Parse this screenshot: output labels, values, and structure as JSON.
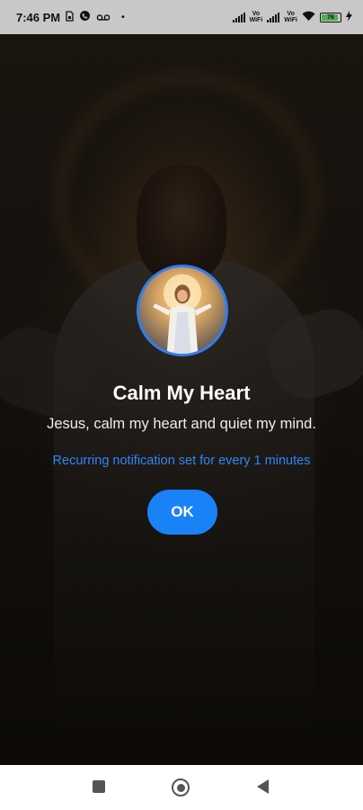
{
  "status_bar": {
    "time": "7:46 PM",
    "left_icons": [
      "sim-icon",
      "whatsapp-icon",
      "voicemail-icon"
    ],
    "dot": "•",
    "vowifi_1": "Vo\nWiFi",
    "vowifi_2": "Vo\nWiFi",
    "battery_level": "76",
    "charging": true
  },
  "dialog": {
    "title": "Calm My Heart",
    "message": "Jesus, calm my heart and quiet my mind.",
    "notice": "Recurring notification set for every 1 minutes",
    "ok_label": "OK",
    "accent_color": "#1a82f7"
  },
  "nav_bar": {
    "buttons": [
      "recents-button",
      "home-button",
      "back-button"
    ]
  }
}
